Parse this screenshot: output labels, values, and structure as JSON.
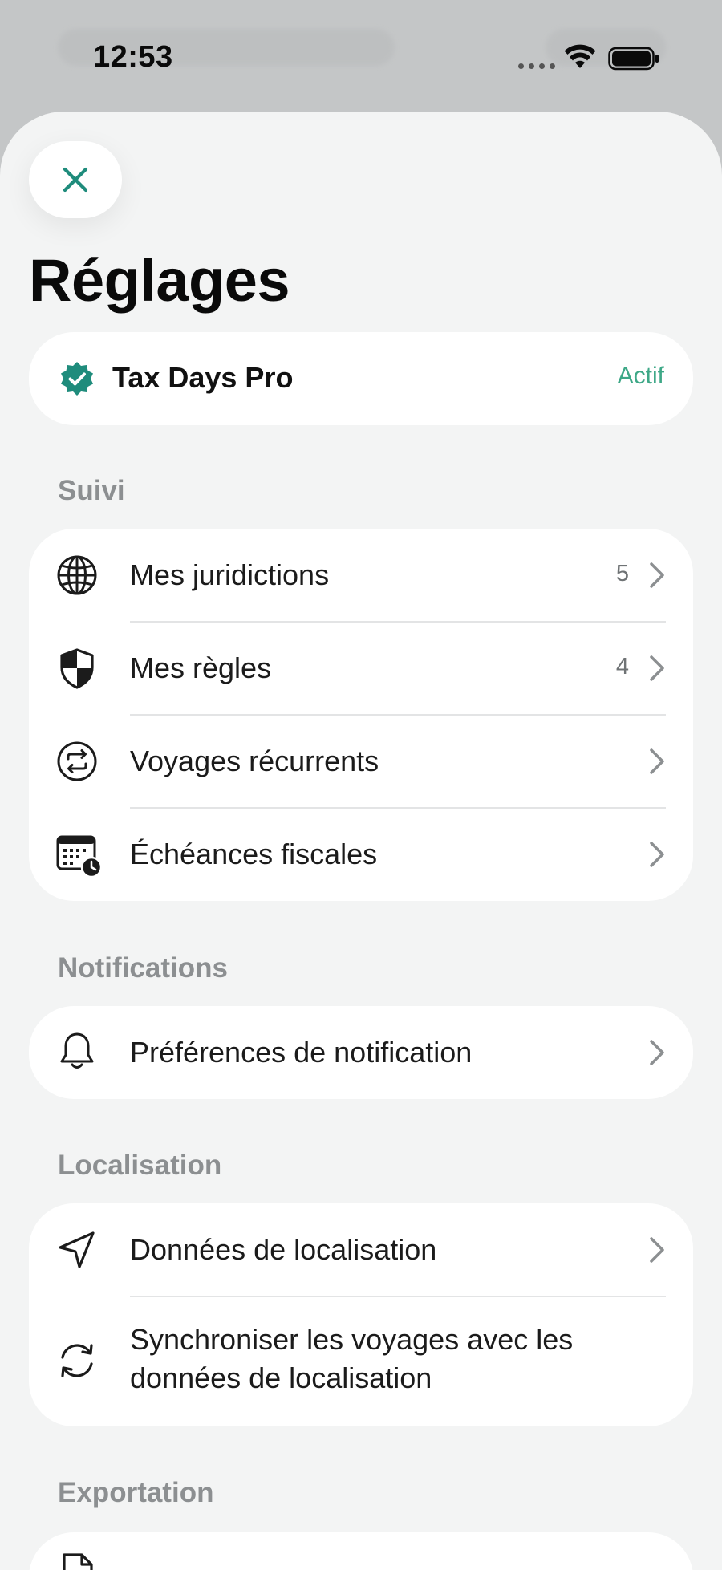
{
  "status_bar": {
    "time": "12:53"
  },
  "sheet": {
    "title": "Réglages"
  },
  "subscription": {
    "name": "Tax Days Pro",
    "status": "Actif",
    "status_color": "#3ea887",
    "badge_color": "#1f8c7c"
  },
  "sections": {
    "tracking": {
      "label": "Suivi",
      "items": [
        {
          "label": "Mes juridictions",
          "count": "5",
          "icon": "globe-icon"
        },
        {
          "label": "Mes règles",
          "count": "4",
          "icon": "shield-icon"
        },
        {
          "label": "Voyages récurrents",
          "count": "",
          "icon": "repeat-icon"
        },
        {
          "label": "Échéances fiscales",
          "count": "",
          "icon": "calendar-clock-icon"
        }
      ]
    },
    "notifications": {
      "label": "Notifications",
      "items": [
        {
          "label": "Préférences de notification",
          "icon": "bell-icon"
        }
      ]
    },
    "location": {
      "label": "Localisation",
      "items": [
        {
          "label": "Données de localisation",
          "icon": "location-arrow-icon"
        },
        {
          "label": "Synchroniser les voyages avec les données de localisation",
          "line1": "Synchroniser les voyages avec les",
          "line2": "données de localisation",
          "icon": "sync-icon"
        }
      ]
    },
    "export": {
      "label": "Exportation"
    }
  },
  "colors": {
    "accent": "#1f8c7c",
    "sheet_background": "#f3f4f4",
    "card_background": "#ffffff",
    "section_label": "#8c8f91"
  }
}
